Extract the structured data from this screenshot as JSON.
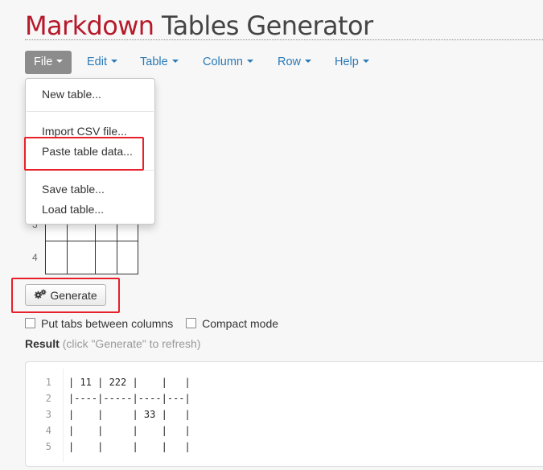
{
  "header": {
    "title_brand": "Markdown",
    "title_rest": " Tables Generator"
  },
  "menubar": {
    "file": "File",
    "edit": "Edit",
    "table": "Table",
    "column": "Column",
    "row": "Row",
    "help": "Help"
  },
  "file_menu": {
    "items": [
      "New table...",
      "Import CSV file...",
      "Paste table data...",
      "Save table...",
      "Load table..."
    ]
  },
  "grid": {
    "row_numbers": [
      "3",
      "4"
    ]
  },
  "generate_label": "Generate",
  "options": {
    "tabs_label": "Put tabs between columns",
    "compact_label": "Compact mode"
  },
  "result": {
    "label": "Result",
    "hint": "(click \"Generate\" to refresh)"
  },
  "output": {
    "line_numbers": [
      "1",
      "2",
      "3",
      "4",
      "5"
    ],
    "lines": [
      "| 11 | 222 |    |   |",
      "|----|-----|----|---|",
      "|    |     | 33 |   |",
      "|    |     |    |   |",
      "|    |     |    |   |"
    ]
  },
  "colors": {
    "brand": "#b51a2b",
    "link": "#2a7ab8",
    "active_menu": "#8c8c8c",
    "highlight": "#e8202a"
  },
  "icons": {
    "generate": "gears-icon",
    "menu_caret": "caret-down-icon"
  }
}
